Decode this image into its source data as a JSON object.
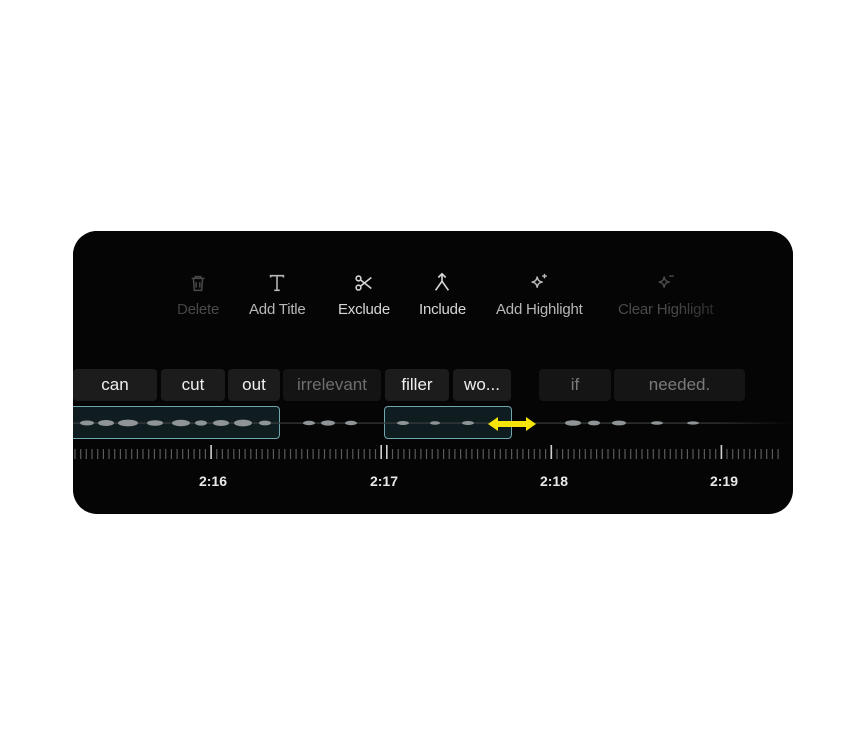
{
  "toolbar": {
    "items": [
      {
        "label": "Delete",
        "icon": "trash-icon",
        "state": "disabled"
      },
      {
        "label": "Add Title",
        "icon": "text-t-icon",
        "state": "enabled"
      },
      {
        "label": "Exclude",
        "icon": "scissors-icon",
        "state": "enabled"
      },
      {
        "label": "Include",
        "icon": "merge-icon",
        "state": "enabled"
      },
      {
        "label": "Add Highlight",
        "icon": "sparkle-plus-icon",
        "state": "enabled"
      },
      {
        "label": "Clear Highlight",
        "icon": "sparkle-minus-icon",
        "state": "disabled"
      }
    ]
  },
  "transcript": {
    "words": [
      {
        "text": "can",
        "state": "included"
      },
      {
        "text": "cut",
        "state": "included"
      },
      {
        "text": "out",
        "state": "included"
      },
      {
        "text": "irrelevant",
        "state": "excluded"
      },
      {
        "text": "filler",
        "state": "included"
      },
      {
        "text": "wo...",
        "state": "included"
      },
      {
        "text": "if",
        "state": "excluded"
      },
      {
        "text": "needed.",
        "state": "excluded"
      }
    ]
  },
  "timeline": {
    "times": [
      "2:16",
      "2:17",
      "2:18",
      "2:19"
    ]
  },
  "colors": {
    "panel_bg": "#050505",
    "clip_border": "#6fa5ad",
    "resize_arrow": "#f5e50b"
  },
  "icons": {
    "resize": "double-arrow-icon"
  }
}
